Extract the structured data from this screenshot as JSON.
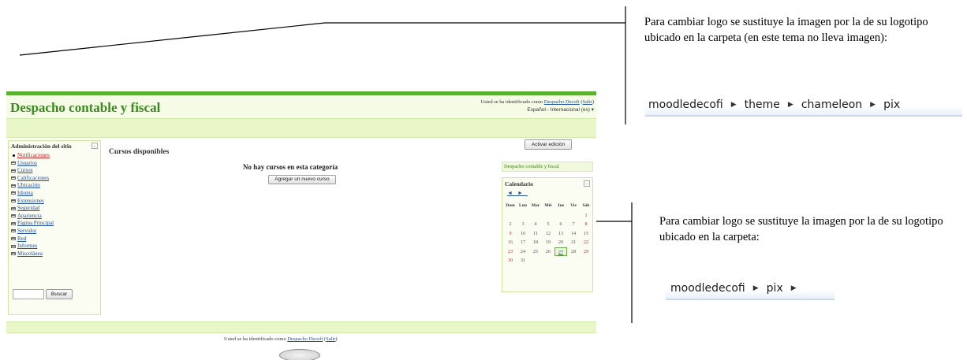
{
  "notes": {
    "top": "Para cambiar logo se sustituye la imagen por la de su logotipo ubicado en la carpeta (en este tema no lleva imagen):",
    "bottom": "Para cambiar logo se sustituye la imagen por la de su logotipo ubicado en la carpeta:"
  },
  "paths": {
    "top": [
      "moodledecofi",
      "theme",
      "chameleon",
      "pix"
    ],
    "bottom": [
      "moodledecofi",
      "pix"
    ]
  },
  "moodle": {
    "site_title": "Despacho contable y fiscal",
    "login_prefix": "Usted se ha identificado como",
    "login_user": "Despacho Decofi",
    "login_logout": "Salir",
    "language": "Español - Internacional (es)",
    "admin_block": {
      "title": "Administración del sitio",
      "items": [
        "Notificaciones",
        "Usuarios",
        "Cursos",
        "Calificaciones",
        "Ubicación",
        "Idioma",
        "Extensiones",
        "Seguridad",
        "Apariencia",
        "Página Principal",
        "Servidor",
        "Red",
        "Informes",
        "Miscelánea"
      ],
      "search_button": "Buscar"
    },
    "courses_title": "Cursos disponibles",
    "no_courses": "No hay cursos en esta categoría",
    "add_course_button": "Agregar un nuevo curso",
    "edit_button": "Activar edición",
    "site_block": "Despacho contable y fiscal",
    "calendar": {
      "title": "Calendario",
      "prev": "◄",
      "next": "►",
      "days": [
        "Dom",
        "Lun",
        "Mar",
        "Mié",
        "Jue",
        "Vie",
        "Sáb"
      ],
      "weeks": [
        [
          "",
          "",
          "",
          "",
          "",
          "",
          "1"
        ],
        [
          "2",
          "3",
          "4",
          "5",
          "6",
          "7",
          "8"
        ],
        [
          "9",
          "10",
          "11",
          "12",
          "13",
          "14",
          "15"
        ],
        [
          "16",
          "17",
          "18",
          "19",
          "20",
          "21",
          "22"
        ],
        [
          "23",
          "24",
          "25",
          "26",
          "27",
          "28",
          "29"
        ],
        [
          "30",
          "31",
          "",
          "",
          "",
          "",
          ""
        ]
      ],
      "today": "27"
    },
    "footer_prefix": "Usted se ha identificado como",
    "footer_user": "Despacho Decofi",
    "footer_logout": "Salir"
  }
}
